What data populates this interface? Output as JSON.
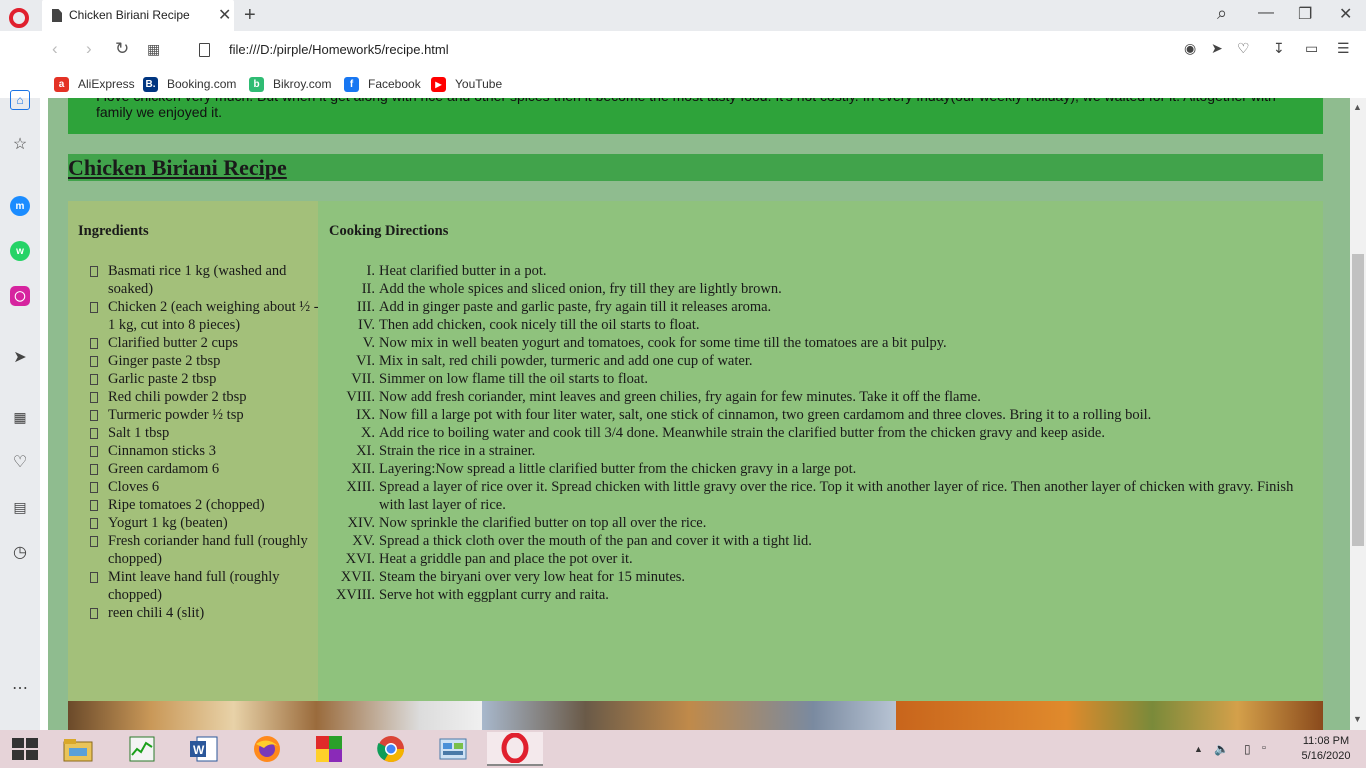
{
  "tab": {
    "title": "Chicken Biriani Recipe",
    "close": "✕",
    "new_tab": "+"
  },
  "window": {
    "search": "⌕",
    "minimize": "—",
    "restore": "❐",
    "close": "✕"
  },
  "address": {
    "url": "file:///D:/pirple/Homework5/recipe.html"
  },
  "bookmarks": [
    {
      "label": "AliExpress",
      "icon_glyph": "a",
      "color": "#e43225"
    },
    {
      "label": "Booking.com",
      "icon_glyph": "B.",
      "color": "#003580"
    },
    {
      "label": "Bikroy.com",
      "icon_glyph": "b",
      "color": "#2fbc73"
    },
    {
      "label": "Facebook",
      "icon_glyph": "f",
      "color": "#1877f2"
    },
    {
      "label": "YouTube",
      "icon_glyph": "▶",
      "color": "#ff0000"
    }
  ],
  "page": {
    "intro": "I love chicken very much. But when it get along with rice and other spices then it become the most tasty food. It's not costly. In every friday(our weekly holiday), we waited for it. Altogether with family we enjoyed it.",
    "heading": "Chicken Biriani Recipe",
    "ingredients_title": "Ingredients",
    "directions_title": "Cooking Directions",
    "ingredients": [
      "Basmati rice 1 kg (washed and soaked)",
      "Chicken 2 (each weighing about ½ - 1 kg, cut into 8 pieces)",
      "Clarified butter 2 cups",
      "Ginger paste 2 tbsp",
      "Garlic paste 2 tbsp",
      "Red chili powder 2 tbsp",
      "Turmeric powder ½ tsp",
      "Salt 1 tbsp",
      "Cinnamon sticks 3",
      "Green cardamom 6",
      "Cloves 6",
      "Ripe tomatoes 2 (chopped)",
      "Yogurt 1 kg (beaten)",
      "Fresh coriander hand full (roughly chopped)",
      "Mint leave hand full (roughly chopped)",
      "reen chili 4 (slit)"
    ],
    "directions": [
      {
        "num": "I.",
        "text": "Heat clarified butter in a pot."
      },
      {
        "num": "II.",
        "text": "Add the whole spices and sliced onion, fry till they are lightly brown."
      },
      {
        "num": "III.",
        "text": "Add in ginger paste and garlic paste, fry again till it releases aroma."
      },
      {
        "num": "IV.",
        "text": "Then add chicken, cook nicely till the oil starts to float."
      },
      {
        "num": "V.",
        "text": "Now mix in well beaten yogurt and tomatoes, cook for some time till the tomatoes are a bit pulpy."
      },
      {
        "num": "VI.",
        "text": "Mix in salt, red chili powder, turmeric and add one cup of water."
      },
      {
        "num": "VII.",
        "text": "Simmer on low flame till the oil starts to float."
      },
      {
        "num": "VIII.",
        "text": "Now add fresh coriander, mint leaves and green chilies, fry again for few minutes. Take it off the flame."
      },
      {
        "num": "IX.",
        "text": "Now fill a large pot with four liter water, salt, one stick of cinnamon, two green cardamom and three cloves. Bring it to a rolling boil."
      },
      {
        "num": "X.",
        "text": "Add rice to boiling water and cook till 3/4 done. Meanwhile strain the clarified butter from the chicken gravy and keep aside."
      },
      {
        "num": "XI.",
        "text": "Strain the rice in a strainer."
      },
      {
        "num": "XII.",
        "text": "Layering:Now spread a little clarified butter from the chicken gravy in a large pot."
      },
      {
        "num": "XIII.",
        "text": "Spread a layer of rice over it. Spread chicken with little gravy over the rice. Top it with another layer of rice. Then another layer of chicken with gravy. Finish with last layer of rice."
      },
      {
        "num": "XIV.",
        "text": "Now sprinkle the clarified butter on top all over the rice."
      },
      {
        "num": "XV.",
        "text": "Spread a thick cloth over the mouth of the pan and cover it with a tight lid."
      },
      {
        "num": "XVI.",
        "text": "Heat a griddle pan and place the pot over it."
      },
      {
        "num": "XVII.",
        "text": "Steam the biryani over very low heat for 15 minutes."
      },
      {
        "num": "XVIII.",
        "text": "Serve hot with eggplant curry and raita."
      }
    ]
  },
  "taskbar": {
    "time": "11:08 PM",
    "date": "5/16/2020"
  },
  "colors": {
    "page_bg": "#8fbc8f",
    "intro_bg": "#2ea33a",
    "heading_bg": "#41a34b",
    "ingredients_bg": "#a3c07a",
    "directions_bg": "#8fc27d"
  }
}
